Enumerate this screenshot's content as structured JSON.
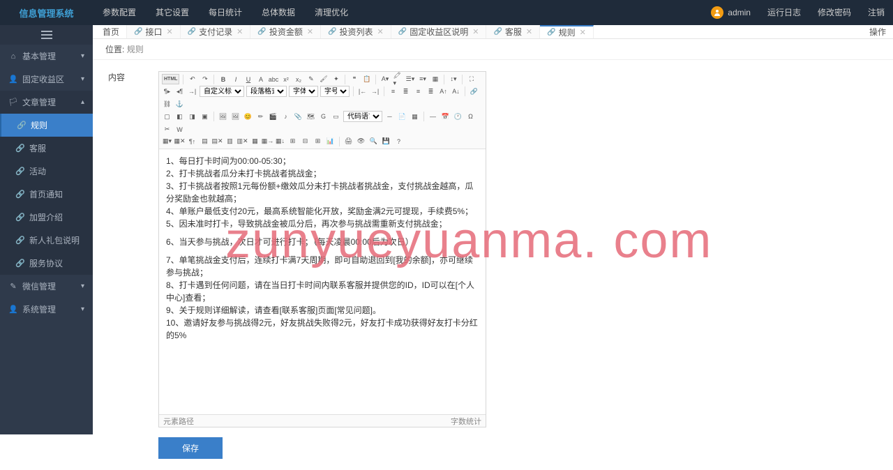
{
  "brand": "信息管理系统",
  "topnav": [
    "参数配置",
    "其它设置",
    "每日统计",
    "总体数据",
    "清理优化"
  ],
  "user": "admin",
  "topright": [
    "运行日志",
    "修改密码",
    "注销"
  ],
  "sidebar": [
    {
      "label": "基本管理",
      "icon": "⌂",
      "level": 1,
      "expand": "▾"
    },
    {
      "label": "固定收益区",
      "icon": "👤",
      "level": 1,
      "expand": "▾"
    },
    {
      "label": "文章管理",
      "icon": "🏳",
      "level": 1,
      "expand": "▴",
      "open": true
    },
    {
      "label": "规则",
      "icon": "🔗",
      "level": 2,
      "active": true
    },
    {
      "label": "客服",
      "icon": "🔗",
      "level": 2
    },
    {
      "label": "活动",
      "icon": "🔗",
      "level": 2
    },
    {
      "label": "首页通知",
      "icon": "🔗",
      "level": 2
    },
    {
      "label": "加盟介绍",
      "icon": "🔗",
      "level": 2
    },
    {
      "label": "新人礼包说明",
      "icon": "🔗",
      "level": 2
    },
    {
      "label": "服务协议",
      "icon": "🔗",
      "level": 2
    },
    {
      "label": "微信管理",
      "icon": "✎",
      "level": 1,
      "expand": "▾"
    },
    {
      "label": "系统管理",
      "icon": "👤",
      "level": 1,
      "expand": "▾"
    }
  ],
  "tabs": [
    {
      "label": "首页",
      "home": true
    },
    {
      "label": "接口"
    },
    {
      "label": "支付记录"
    },
    {
      "label": "投资金额"
    },
    {
      "label": "投资列表"
    },
    {
      "label": "固定收益区说明"
    },
    {
      "label": "客服"
    },
    {
      "label": "规则",
      "active": true
    }
  ],
  "ops_label": "操作",
  "crumb": {
    "label": "位置:",
    "current": "规则"
  },
  "form": {
    "content_label": "内容",
    "save": "保存"
  },
  "editor_selects": {
    "custom_title": "自定义标题",
    "para_format": "段落格式",
    "font": "字体",
    "font_size": "字号",
    "code_lang": "代码语言"
  },
  "editor_lines": [
    "1、每日打卡时间为00:00-05:30；",
    "2、打卡挑战者瓜分未打卡挑战者挑战金；",
    "3、打卡挑战者按照1元每份额+缴效瓜分未打卡挑战者挑战金，支付挑战金越高，瓜分奖励金也就越高；",
    "4、单账户最低支付20元，最高系统智能化开放，奖励金满2元可提现，手续费5%；",
    "5、因未准时打卡，导致挑战金被瓜分后，再次参与挑战需重新支付挑战金；",
    "6、当天参与挑战，次日才可进行打卡；（每天凌晨00:00后为次日）",
    "7、单笔挑战金支付后，连续打卡满7天周期，即可自助退回到[我的余额]，亦可继续参与挑战；",
    "8、打卡遇到任何问题，请在当日打卡时间内联系客服并提供您的ID，ID可以在[个人中心]查看；",
    "9、关于规则详细解读，请查看[联系客服]页面[常见问题]。",
    "10、邀请好友参与挑战得2元，好友挑战失败得2元，好友打卡成功获得好友打卡分红的5%"
  ],
  "statusbar": {
    "path": "元素路径",
    "count": "字数统计"
  },
  "watermark": "zunyueyuanma. com"
}
